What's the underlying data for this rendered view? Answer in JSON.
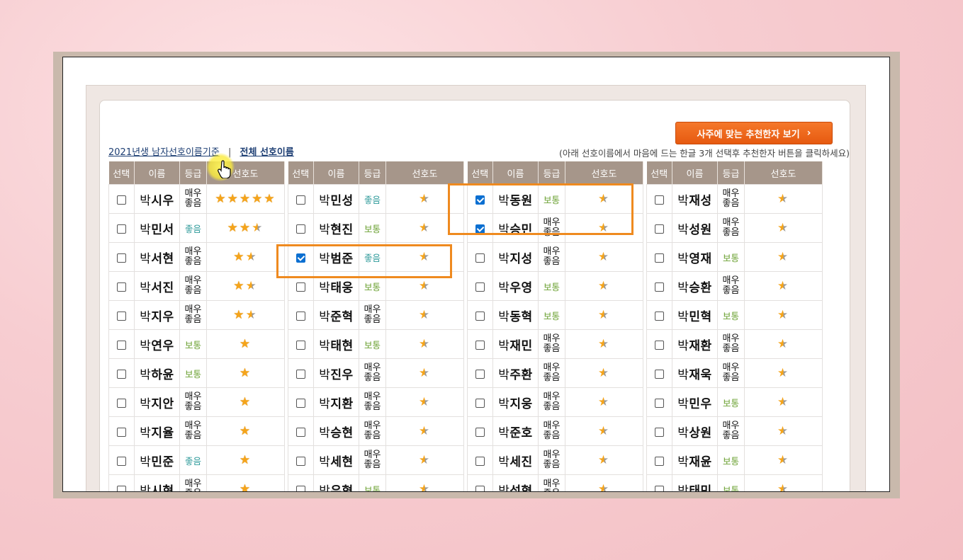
{
  "recommend_button": {
    "label": "사주에 맞는 추천한자 보기",
    "icon": "chevron-right-icon"
  },
  "links": {
    "current": "2021년생 남자선호이름기준",
    "separator": "|",
    "all": "전체 선호이름"
  },
  "hint": "(아래 선호이름에서 마음에 드는 한글 3개 선택후 추천한자 버튼을 클릭하세요)",
  "headers": {
    "select": "선택",
    "name": "이름",
    "grade": "등급",
    "preference": "선호도"
  },
  "star_glyph": "★",
  "columns": [
    [
      {
        "surname": "박",
        "given": "시우",
        "grade": "매우좋음",
        "grade_class": "g-best",
        "stars": 5,
        "checked": false
      },
      {
        "surname": "박",
        "given": "민서",
        "grade": "좋음",
        "grade_class": "g-good",
        "stars": 2.5,
        "checked": false
      },
      {
        "surname": "박",
        "given": "서현",
        "grade": "매우좋음",
        "grade_class": "g-best",
        "stars": 1.5,
        "checked": false
      },
      {
        "surname": "박",
        "given": "서진",
        "grade": "매우좋음",
        "grade_class": "g-best",
        "stars": 1.5,
        "checked": false
      },
      {
        "surname": "박",
        "given": "지우",
        "grade": "매우좋음",
        "grade_class": "g-best",
        "stars": 1.5,
        "checked": false
      },
      {
        "surname": "박",
        "given": "연우",
        "grade": "보통",
        "grade_class": "g-norm",
        "stars": 1,
        "checked": false
      },
      {
        "surname": "박",
        "given": "하윤",
        "grade": "보통",
        "grade_class": "g-norm",
        "stars": 1,
        "checked": false
      },
      {
        "surname": "박",
        "given": "지안",
        "grade": "매우좋음",
        "grade_class": "g-best",
        "stars": 1,
        "checked": false
      },
      {
        "surname": "박",
        "given": "지율",
        "grade": "매우좋음",
        "grade_class": "g-best",
        "stars": 1,
        "checked": false
      },
      {
        "surname": "박",
        "given": "민준",
        "grade": "좋음",
        "grade_class": "g-good",
        "stars": 1,
        "checked": false
      },
      {
        "surname": "박",
        "given": "시현",
        "grade": "매우좋음",
        "grade_class": "g-best",
        "stars": 1,
        "checked": false
      }
    ],
    [
      {
        "surname": "박",
        "given": "민성",
        "grade": "좋음",
        "grade_class": "g-good",
        "stars": 0.5,
        "checked": false
      },
      {
        "surname": "박",
        "given": "현진",
        "grade": "보통",
        "grade_class": "g-norm",
        "stars": 0.5,
        "checked": false
      },
      {
        "surname": "박",
        "given": "범준",
        "grade": "좋음",
        "grade_class": "g-good",
        "stars": 0.5,
        "checked": true
      },
      {
        "surname": "박",
        "given": "태웅",
        "grade": "보통",
        "grade_class": "g-norm",
        "stars": 0.5,
        "checked": false
      },
      {
        "surname": "박",
        "given": "준혁",
        "grade": "매우좋음",
        "grade_class": "g-best",
        "stars": 0.5,
        "checked": false
      },
      {
        "surname": "박",
        "given": "태현",
        "grade": "보통",
        "grade_class": "g-norm",
        "stars": 0.5,
        "checked": false
      },
      {
        "surname": "박",
        "given": "진우",
        "grade": "매우좋음",
        "grade_class": "g-best",
        "stars": 0.5,
        "checked": false
      },
      {
        "surname": "박",
        "given": "지환",
        "grade": "매우좋음",
        "grade_class": "g-best",
        "stars": 0.5,
        "checked": false
      },
      {
        "surname": "박",
        "given": "승현",
        "grade": "매우좋음",
        "grade_class": "g-best",
        "stars": 0.5,
        "checked": false
      },
      {
        "surname": "박",
        "given": "세현",
        "grade": "매우좋음",
        "grade_class": "g-best",
        "stars": 0.5,
        "checked": false
      },
      {
        "surname": "박",
        "given": "우혁",
        "grade": "보통",
        "grade_class": "g-norm",
        "stars": 0.5,
        "checked": false
      }
    ],
    [
      {
        "surname": "박",
        "given": "동원",
        "grade": "보통",
        "grade_class": "g-norm",
        "stars": 0.5,
        "checked": true
      },
      {
        "surname": "박",
        "given": "승민",
        "grade": "매우좋음",
        "grade_class": "g-best",
        "stars": 0.5,
        "checked": true
      },
      {
        "surname": "박",
        "given": "지성",
        "grade": "매우좋음",
        "grade_class": "g-best",
        "stars": 0.5,
        "checked": false
      },
      {
        "surname": "박",
        "given": "우영",
        "grade": "보통",
        "grade_class": "g-norm",
        "stars": 0.5,
        "checked": false
      },
      {
        "surname": "박",
        "given": "동혁",
        "grade": "보통",
        "grade_class": "g-norm",
        "stars": 0.5,
        "checked": false
      },
      {
        "surname": "박",
        "given": "재민",
        "grade": "매우좋음",
        "grade_class": "g-best",
        "stars": 0.5,
        "checked": false
      },
      {
        "surname": "박",
        "given": "주환",
        "grade": "매우좋음",
        "grade_class": "g-best",
        "stars": 0.5,
        "checked": false
      },
      {
        "surname": "박",
        "given": "지웅",
        "grade": "매우좋음",
        "grade_class": "g-best",
        "stars": 0.5,
        "checked": false
      },
      {
        "surname": "박",
        "given": "준호",
        "grade": "매우좋음",
        "grade_class": "g-best",
        "stars": 0.5,
        "checked": false
      },
      {
        "surname": "박",
        "given": "세진",
        "grade": "매우좋음",
        "grade_class": "g-best",
        "stars": 0.5,
        "checked": false
      },
      {
        "surname": "박",
        "given": "성혁",
        "grade": "매우좋음",
        "grade_class": "g-best",
        "stars": 0.5,
        "checked": false
      }
    ],
    [
      {
        "surname": "박",
        "given": "재성",
        "grade": "매우좋음",
        "grade_class": "g-best",
        "stars": 0.5,
        "checked": false
      },
      {
        "surname": "박",
        "given": "성원",
        "grade": "매우좋음",
        "grade_class": "g-best",
        "stars": 0.5,
        "checked": false
      },
      {
        "surname": "박",
        "given": "영재",
        "grade": "보통",
        "grade_class": "g-norm",
        "stars": 0.5,
        "checked": false
      },
      {
        "surname": "박",
        "given": "승환",
        "grade": "매우좋음",
        "grade_class": "g-best",
        "stars": 0.5,
        "checked": false
      },
      {
        "surname": "박",
        "given": "민혁",
        "grade": "보통",
        "grade_class": "g-norm",
        "stars": 0.5,
        "checked": false
      },
      {
        "surname": "박",
        "given": "재환",
        "grade": "매우좋음",
        "grade_class": "g-best",
        "stars": 0.5,
        "checked": false
      },
      {
        "surname": "박",
        "given": "재욱",
        "grade": "매우좋음",
        "grade_class": "g-best",
        "stars": 0.5,
        "checked": false
      },
      {
        "surname": "박",
        "given": "민우",
        "grade": "보통",
        "grade_class": "g-norm",
        "stars": 0.5,
        "checked": false
      },
      {
        "surname": "박",
        "given": "상원",
        "grade": "매우좋음",
        "grade_class": "g-best",
        "stars": 0.5,
        "checked": false
      },
      {
        "surname": "박",
        "given": "재윤",
        "grade": "보통",
        "grade_class": "g-norm",
        "stars": 0.5,
        "checked": false
      },
      {
        "surname": "박",
        "given": "태민",
        "grade": "보통",
        "grade_class": "g-norm",
        "stars": 0.5,
        "checked": false
      }
    ]
  ]
}
